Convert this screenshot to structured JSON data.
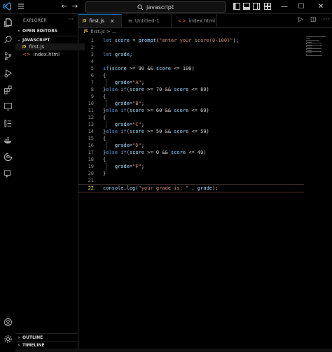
{
  "titlebar": {
    "search_text": "javascript",
    "icons": [
      "vscode-logo-icon",
      "menu-icon",
      "back-icon",
      "forward-icon",
      "search-icon",
      "layout-sidebar-icon",
      "layout-panel-icon",
      "layout-secondary-icon",
      "customize-layout-icon",
      "minimize-icon",
      "maximize-icon",
      "close-icon"
    ]
  },
  "sidebar": {
    "header": "EXPLORER",
    "open_editors": "OPEN EDITORS",
    "folder": "JAVASCRIPT",
    "files": [
      {
        "badge": "JS",
        "name": "first.js"
      },
      {
        "badge": "<>",
        "name": "index.html"
      }
    ],
    "outline": "OUTLINE",
    "timeline": "TIMELINE"
  },
  "tabs": [
    {
      "badge": "JS",
      "label": "first.js"
    },
    {
      "badge": "≡",
      "label": "Untitled-1"
    },
    {
      "badge": "<>",
      "label": "index.html"
    }
  ],
  "breadcrumb": {
    "badge": "JS",
    "file": "first.js",
    "rest": "> ..."
  },
  "editor": {
    "lines": [
      {
        "n": "1",
        "code": "let score = prompt(\"enter your score(0-100)\");"
      },
      {
        "n": "2",
        "code": ""
      },
      {
        "n": "3",
        "code": "let grade;"
      },
      {
        "n": "4",
        "code": ""
      },
      {
        "n": "5",
        "code": "if(score >= 90 && score <= 100)"
      },
      {
        "n": "6",
        "code": "{"
      },
      {
        "n": "7",
        "code": "    grade=\"A\";"
      },
      {
        "n": "8",
        "code": "}else if(score >= 70 && score <= 89)"
      },
      {
        "n": "9",
        "code": "{"
      },
      {
        "n": "10",
        "code": "    grade=\"B\";"
      },
      {
        "n": "11",
        "code": "}else if(score >= 60 && score <= 69)"
      },
      {
        "n": "12",
        "code": "{"
      },
      {
        "n": "13",
        "code": "    grade=\"C\";"
      },
      {
        "n": "14",
        "code": "}else if(score >= 50 && score <= 59)"
      },
      {
        "n": "15",
        "code": "{"
      },
      {
        "n": "16",
        "code": "    grade=\"D\";"
      },
      {
        "n": "17",
        "code": "}else if(score >= 0 && score <= 49)"
      },
      {
        "n": "18",
        "code": "{"
      },
      {
        "n": "19",
        "code": "    grade=\"F\";"
      },
      {
        "n": "20",
        "code": "}"
      },
      {
        "n": "21",
        "code": ""
      },
      {
        "n": "22",
        "code": "console.log(\"your grade is: \" , grade);"
      }
    ],
    "current_line": "22"
  },
  "colors": {
    "keyword": "#5b9bd5",
    "string": "#ce9178",
    "identifier": "#9cdcfe",
    "accent": "#0e70c0"
  }
}
